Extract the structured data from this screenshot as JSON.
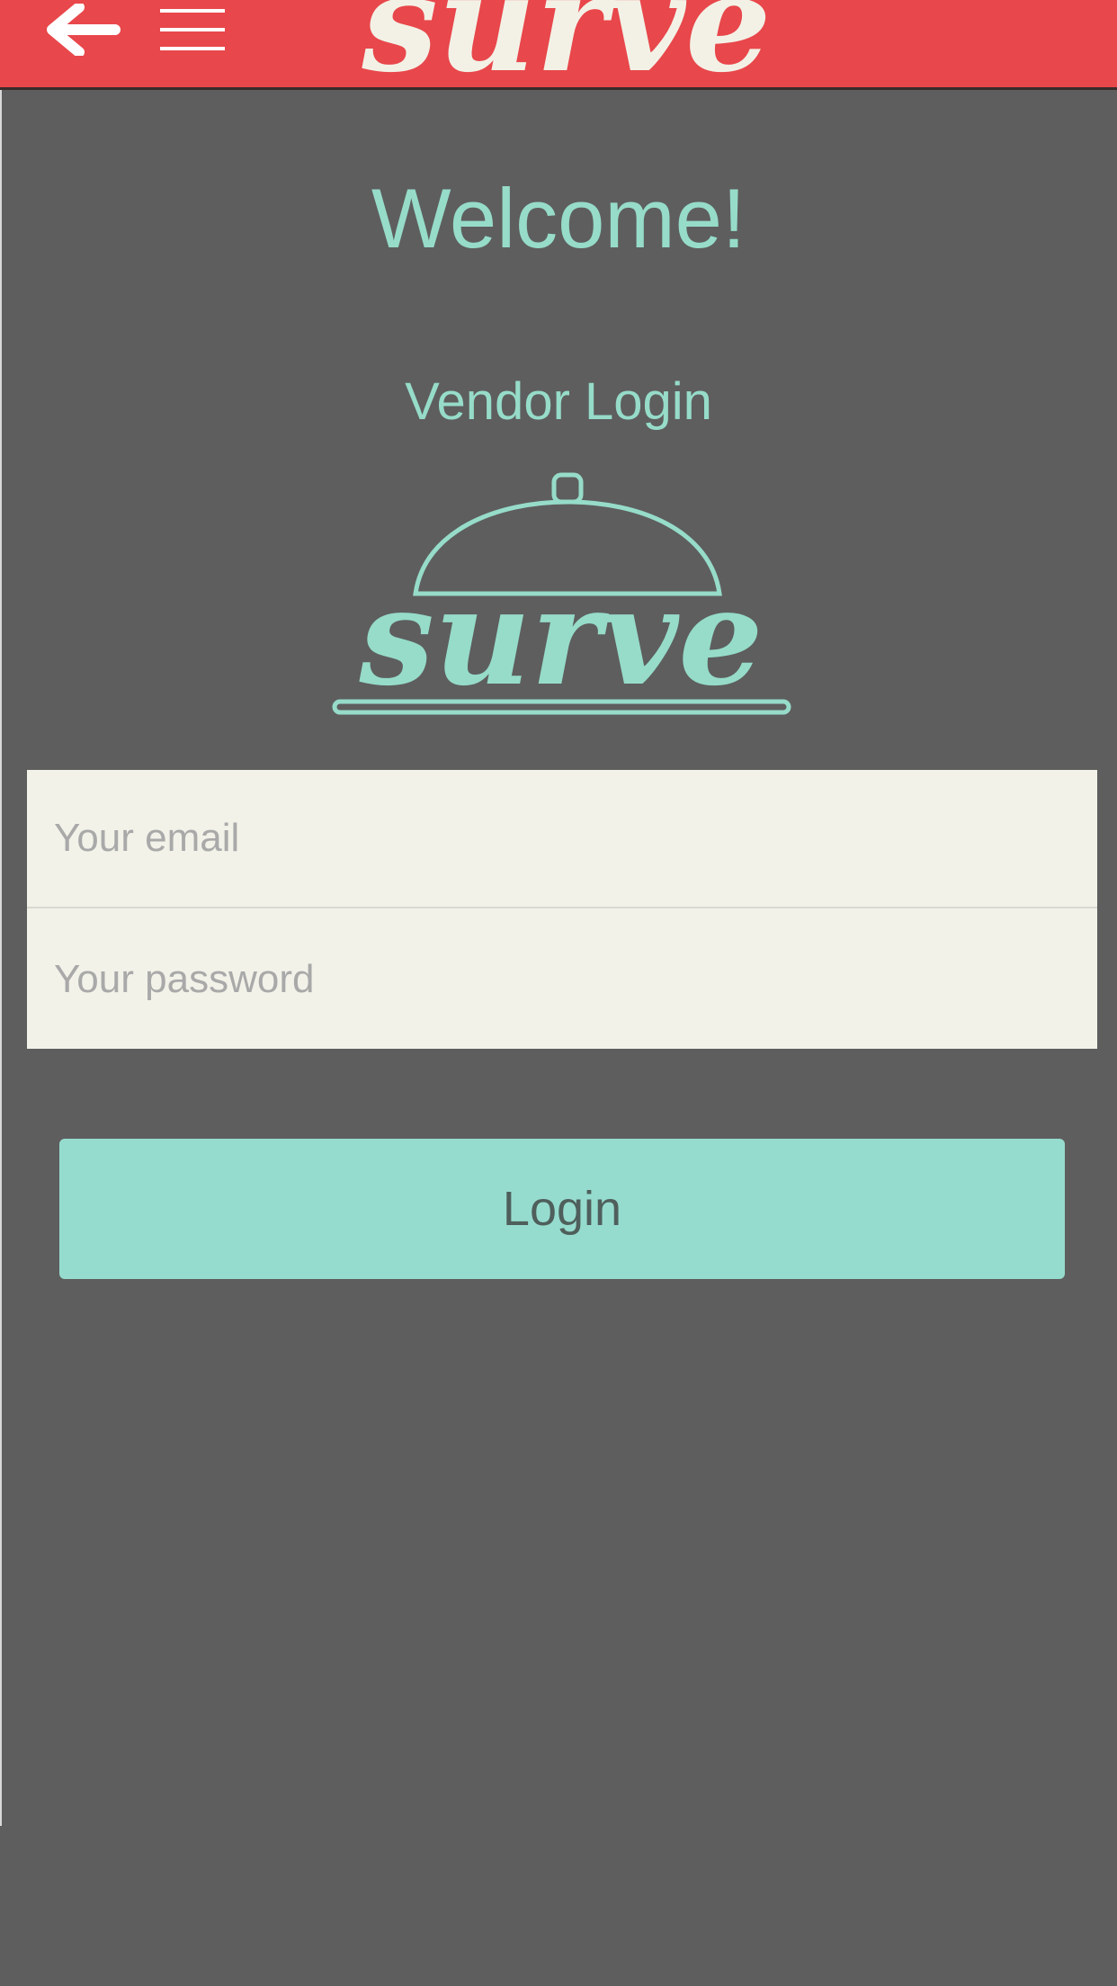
{
  "header": {
    "logo_text": "surve",
    "back_icon": "arrow-left-icon",
    "menu_icon": "hamburger-menu-icon"
  },
  "main": {
    "welcome": "Welcome!",
    "subtitle": "Vendor Login",
    "logo_text": "surve",
    "logo_icon": "serving-cloche-icon"
  },
  "form": {
    "email_placeholder": "Your email",
    "password_placeholder": "Your password",
    "email_value": "",
    "password_value": ""
  },
  "actions": {
    "login_label": "Login"
  },
  "colors": {
    "header_bg": "#e8474b",
    "page_bg": "#5e5e5e",
    "accent": "#96dcc9",
    "field_bg": "#f2f2e9",
    "button_bg": "#96dcce",
    "logo_cream": "#f3f1e6"
  }
}
